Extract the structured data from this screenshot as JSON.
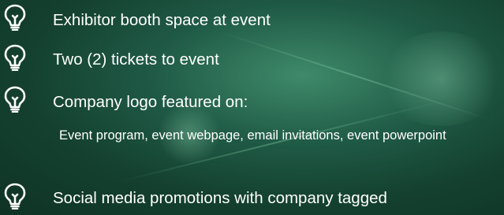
{
  "list": {
    "items": [
      {
        "icon": "lightbulb-icon",
        "text": "Exhibitor booth space at event"
      },
      {
        "icon": "lightbulb-icon",
        "text": "Two (2) tickets to event"
      },
      {
        "icon": "lightbulb-icon",
        "text": "Company logo featured on:",
        "subtext": "Event program, event webpage, email invitations, event powerpoint"
      },
      {
        "icon": "lightbulb-icon",
        "text": "Social media promotions with company tagged"
      }
    ]
  }
}
